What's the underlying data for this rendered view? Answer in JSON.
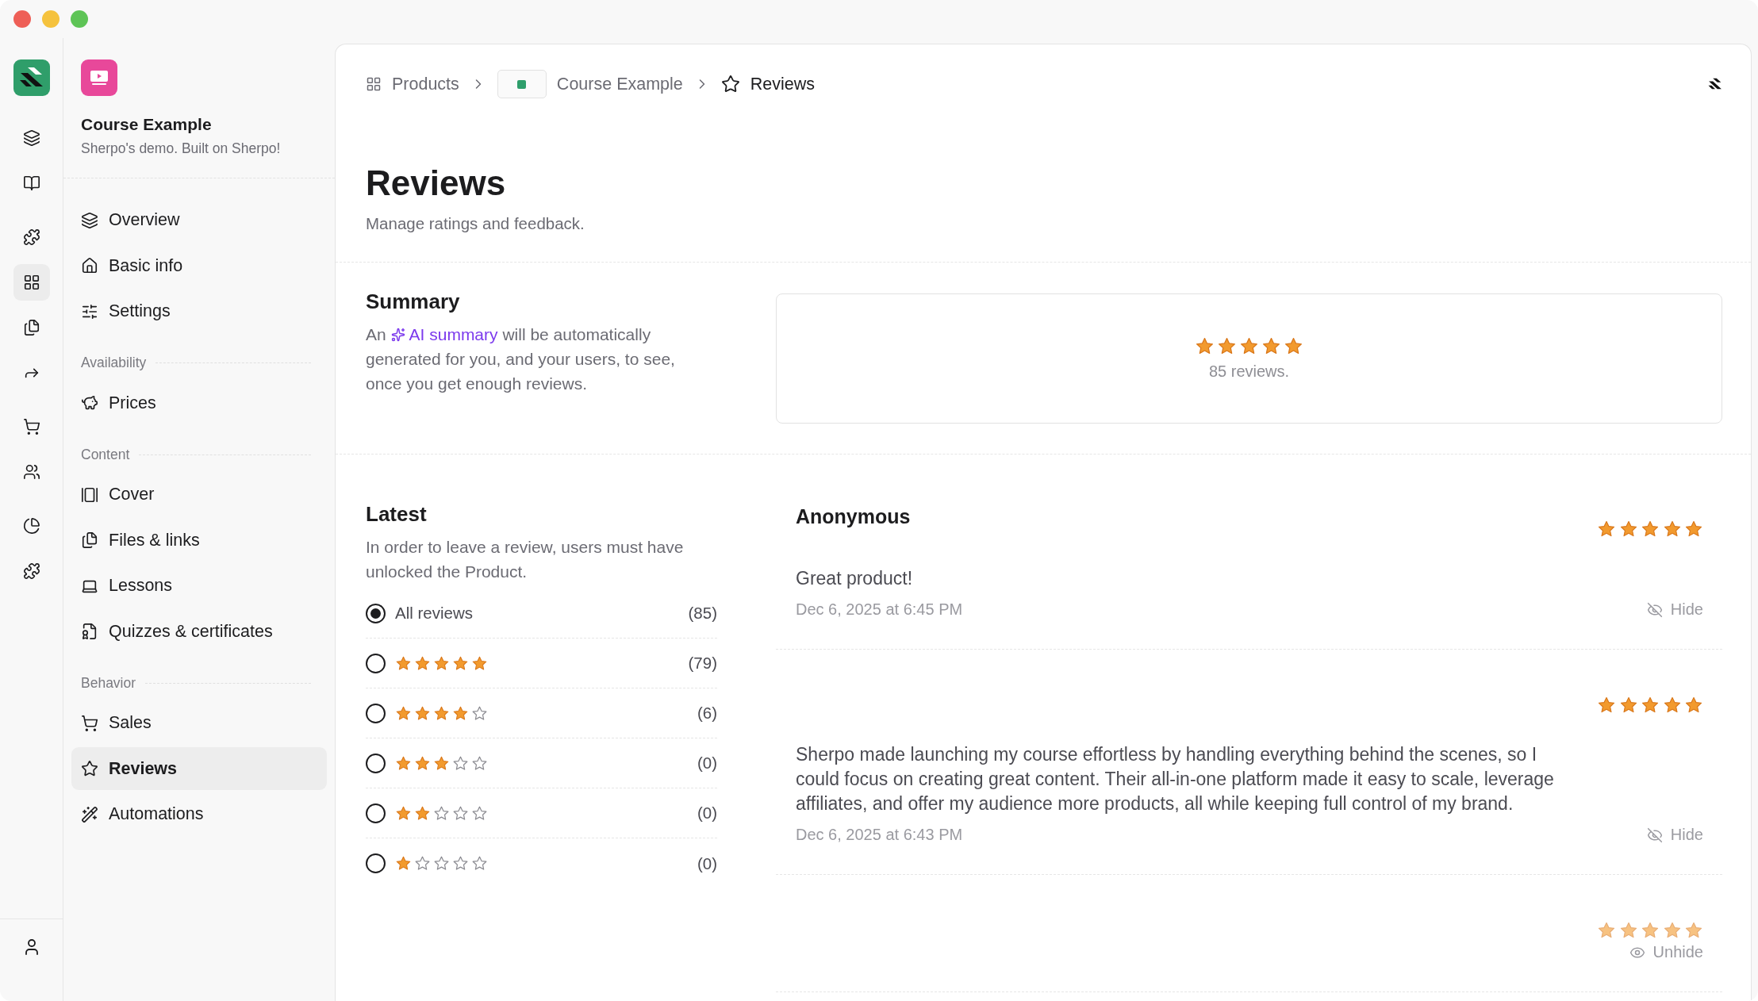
{
  "rail": {
    "groups": [
      [
        {
          "selected": false
        },
        {
          "selected": false
        }
      ],
      [
        {
          "selected": false
        },
        {
          "selected": true
        },
        {
          "selected": false
        },
        {
          "selected": false
        }
      ],
      [
        {
          "selected": false
        },
        {
          "selected": false
        }
      ],
      [
        {
          "selected": false
        },
        {
          "selected": false
        }
      ]
    ]
  },
  "product": {
    "name": "Course Example",
    "tagline": "Sherpo's demo. Built on Sherpo!"
  },
  "nav": [
    {
      "items": [
        {
          "label": "Overview",
          "selected": false
        },
        {
          "label": "Basic info",
          "selected": false
        },
        {
          "label": "Settings",
          "selected": false
        }
      ]
    },
    {
      "heading": "Availability",
      "items": [
        {
          "label": "Prices",
          "selected": false
        }
      ]
    },
    {
      "heading": "Content",
      "items": [
        {
          "label": "Cover",
          "selected": false
        },
        {
          "label": "Files & links",
          "selected": false
        },
        {
          "label": "Lessons",
          "selected": false
        },
        {
          "label": "Quizzes & certificates",
          "selected": false
        }
      ]
    },
    {
      "heading": "Behavior",
      "items": [
        {
          "label": "Sales",
          "selected": false
        },
        {
          "label": "Reviews",
          "selected": true
        },
        {
          "label": "Automations",
          "selected": false
        }
      ]
    }
  ],
  "breadcrumb": [
    "Products",
    "Course Example",
    "Reviews"
  ],
  "page": {
    "title": "Reviews",
    "subtitle": "Manage ratings and feedback."
  },
  "summary": {
    "title": "Summary",
    "text_before": "An",
    "link": "AI summary",
    "text_after": "will be automatically generated for you, and your users, to see, once you get enough reviews.",
    "stars": 5,
    "count": "85 reviews."
  },
  "latest": {
    "title": "Latest",
    "text": "In order to leave a review, users must have unlocked the Product.",
    "filters": [
      {
        "kind": "all",
        "label": "All reviews",
        "count": "(85)",
        "selected": true
      },
      {
        "kind": "stars",
        "stars": 5,
        "count": "(79)",
        "selected": false
      },
      {
        "kind": "stars",
        "stars": 4,
        "count": "(6)",
        "selected": false
      },
      {
        "kind": "stars",
        "stars": 3,
        "count": "(0)",
        "selected": false
      },
      {
        "kind": "stars",
        "stars": 2,
        "count": "(0)",
        "selected": false
      },
      {
        "kind": "stars",
        "stars": 1,
        "count": "(0)",
        "selected": false
      }
    ]
  },
  "reviews": [
    {
      "author": "Anonymous",
      "stars": 5,
      "text": "Great product!",
      "date": "Dec 6, 2025 at 6:45 PM",
      "hidden": false,
      "action": "Hide"
    },
    {
      "stars": 5,
      "text": "Sherpo made launching my course effortless by handling everything behind the scenes, so I could focus on creating great content. Their all-in-one platform made it easy to scale, leverage affiliates, and offer my audience more products, all while keeping full control of my brand.",
      "date": "Dec 6, 2025 at 6:43 PM",
      "hidden": false,
      "action": "Hide"
    },
    {
      "stars": 5,
      "hidden": true,
      "action": "Unhide"
    }
  ]
}
